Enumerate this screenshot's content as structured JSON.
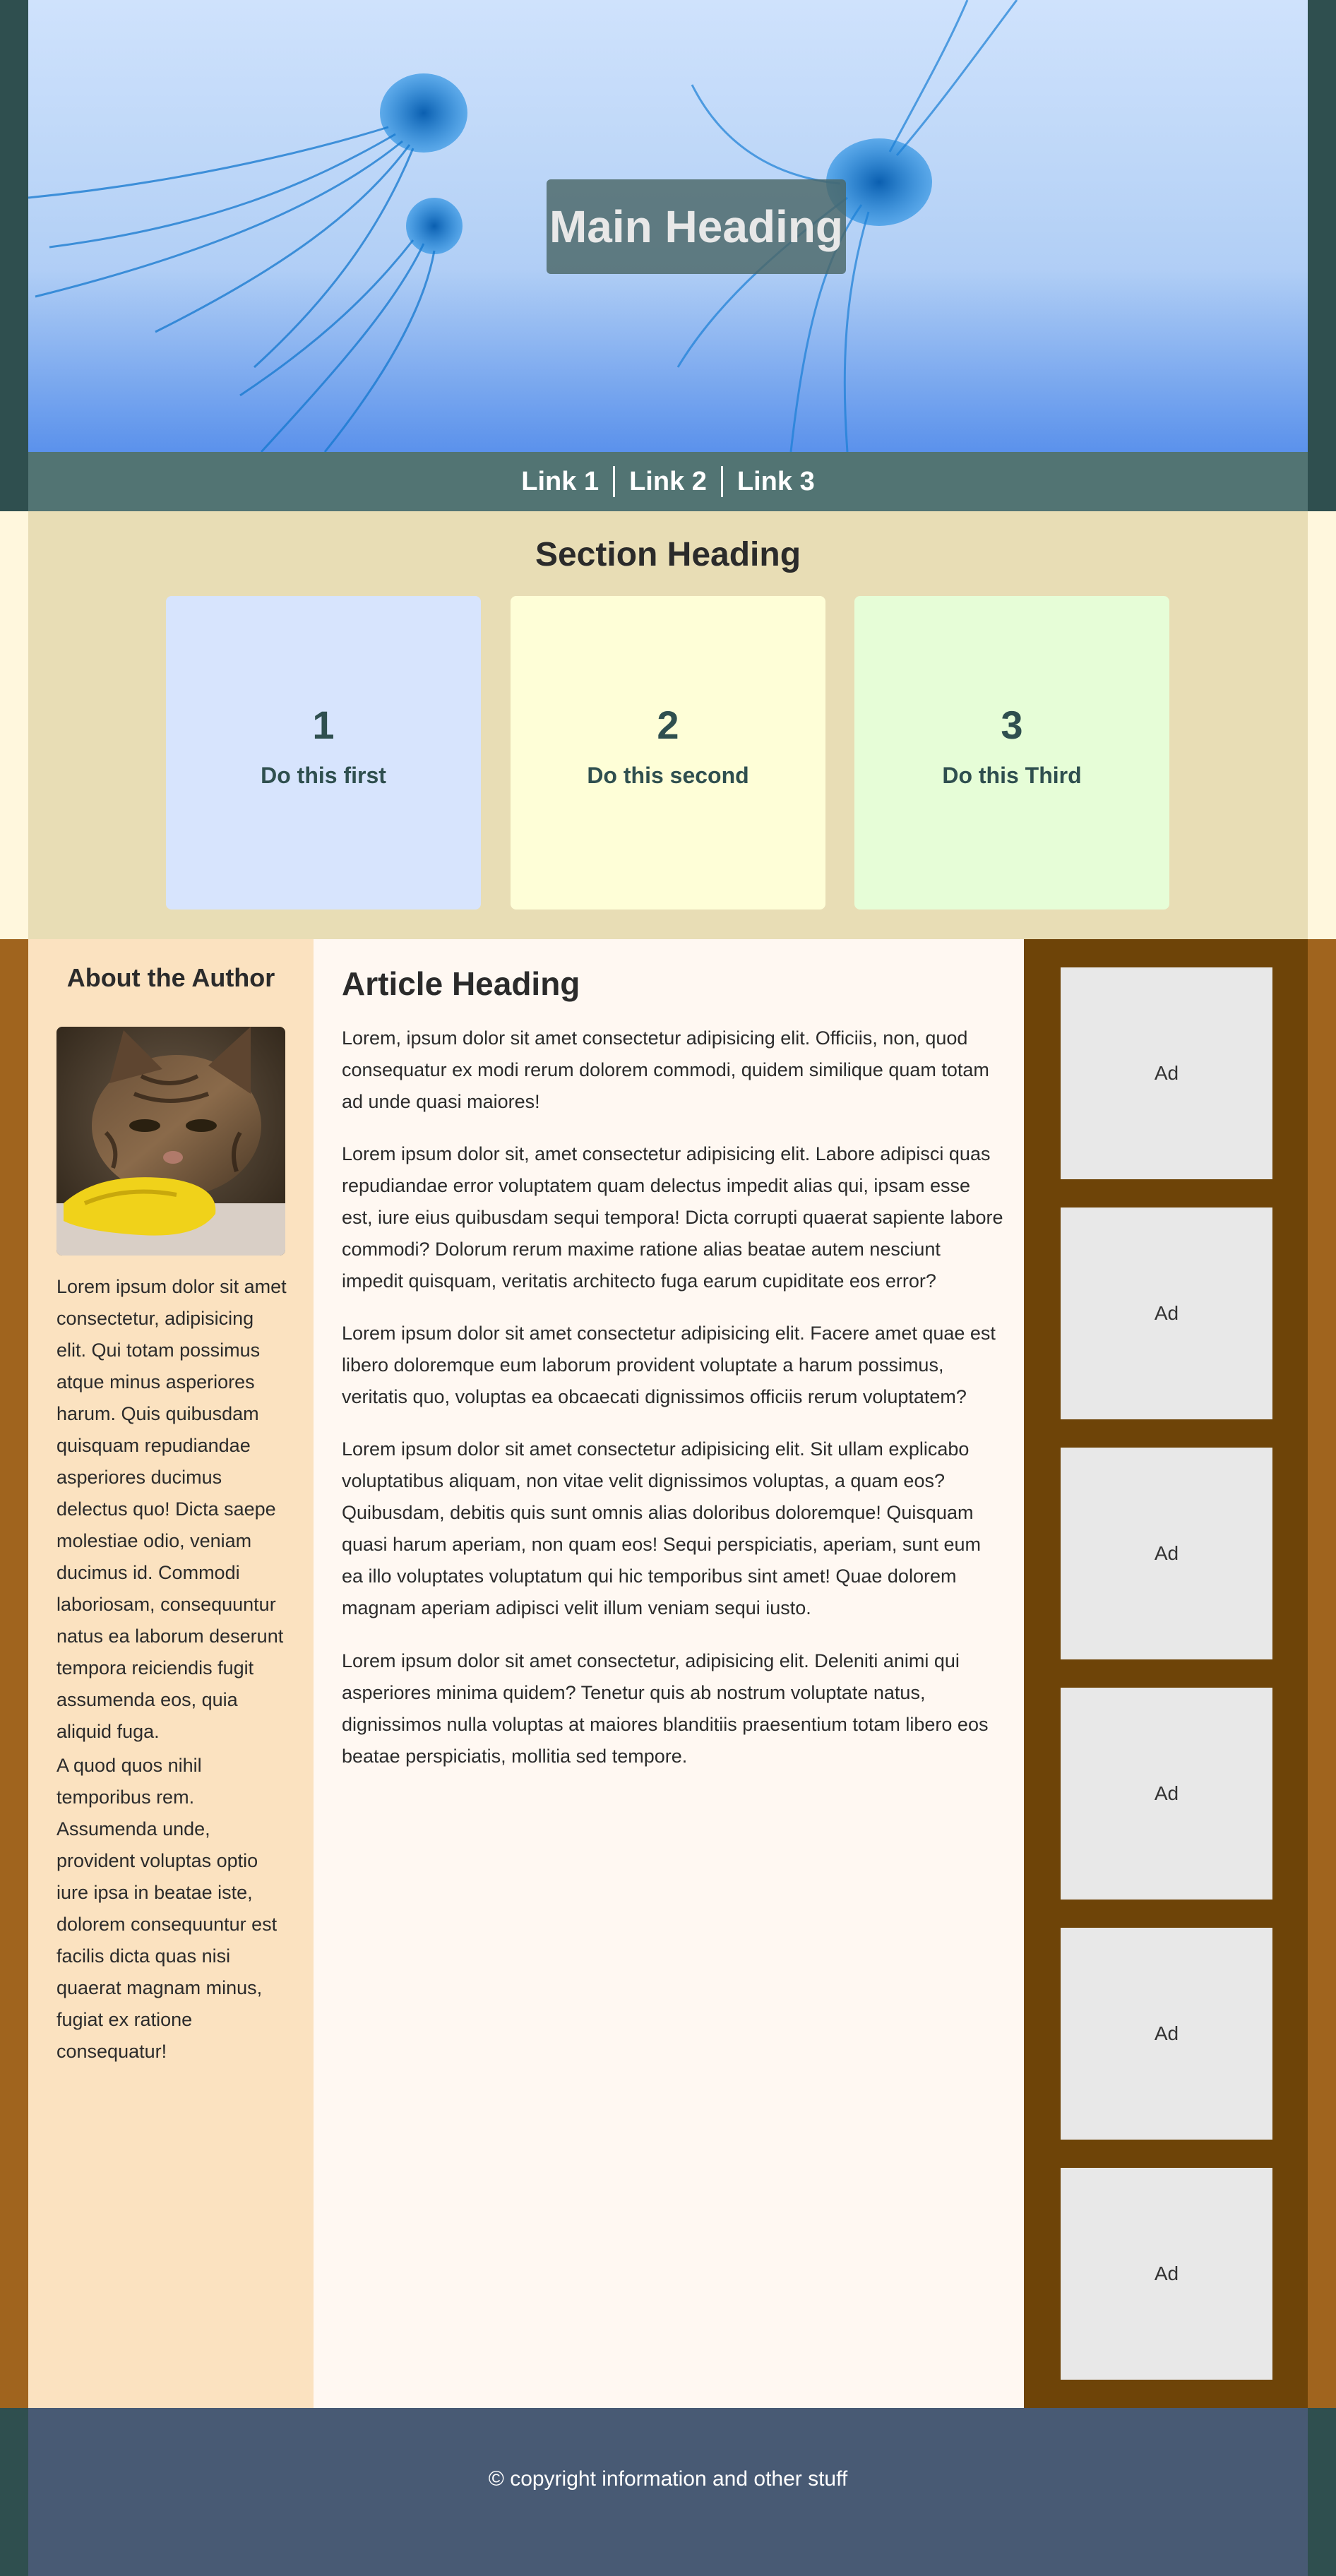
{
  "header": {
    "main_heading": "Main Heading",
    "nav": {
      "links": [
        "Link 1",
        "Link 2",
        "Link 3"
      ]
    }
  },
  "section": {
    "heading": "Section Heading",
    "steps": [
      {
        "number": "1",
        "label": "Do this first",
        "color": "#d7e4fd"
      },
      {
        "number": "2",
        "label": "Do this second",
        "color": "#fefed7"
      },
      {
        "number": "3",
        "label": "Do this Third",
        "color": "#e6fdd7"
      }
    ]
  },
  "author": {
    "heading": "About the Author",
    "image_subject": "cat-photo",
    "paragraphs": [
      "Lorem ipsum dolor sit amet consectetur, adipisicing elit. Qui totam possimus atque minus asperiores harum. Quis quibusdam quisquam repudiandae asperiores ducimus delectus quo! Dicta saepe molestiae odio, veniam ducimus id. Commodi laboriosam, consequuntur natus ea laborum deserunt tempora reiciendis fugit assumenda eos, quia aliquid fuga.",
      "A quod quos nihil temporibus rem. Assumenda unde, provident voluptas optio iure ipsa in beatae iste, dolorem consequuntur est facilis dicta quas nisi quaerat magnam minus, fugiat ex ratione consequatur!"
    ]
  },
  "article": {
    "heading": "Article Heading",
    "paragraphs": [
      "Lorem, ipsum dolor sit amet consectetur adipisicing elit. Officiis, non, quod consequatur ex modi rerum dolorem commodi, quidem similique quam totam ad unde quasi maiores!",
      "Lorem ipsum dolor sit, amet consectetur adipisicing elit. Labore adipisci quas repudiandae error voluptatem quam delectus impedit alias qui, ipsam esse est, iure eius quibusdam sequi tempora! Dicta corrupti quaerat sapiente labore commodi? Dolorum rerum maxime ratione alias beatae autem nesciunt impedit quisquam, veritatis architecto fuga earum cupiditate eos error?",
      "Lorem ipsum dolor sit amet consectetur adipisicing elit. Facere amet quae est libero doloremque eum laborum provident voluptate a harum possimus, veritatis quo, voluptas ea obcaecati dignissimos officiis rerum voluptatem?",
      "Lorem ipsum dolor sit amet consectetur adipisicing elit. Sit ullam explicabo voluptatibus aliquam, non vitae velit dignissimos voluptas, a quam eos? Quibusdam, debitis quis sunt omnis alias doloribus doloremque! Quisquam quasi harum aperiam, non quam eos! Sequi perspiciatis, aperiam, sunt eum ea illo voluptates voluptatum qui hic temporibus sint amet! Quae dolorem magnam aperiam adipisci velit illum veniam sequi iusto.",
      "Lorem ipsum dolor sit amet consectetur, adipisicing elit. Deleniti animi qui asperiores minima quidem? Tenetur quis ab nostrum voluptate natus, dignissimos nulla voluptas at maiores blanditiis praesentium totam libero eos beatae perspiciatis, mollitia sed tempore."
    ]
  },
  "ads": [
    "Ad",
    "Ad",
    "Ad",
    "Ad",
    "Ad",
    "Ad"
  ],
  "footer": {
    "text": "© copyright information and other stuff"
  },
  "colors": {
    "outer_dark": "#2f4f4f",
    "nav_bg": "#527473",
    "section_bg": "#e8ddb5",
    "main_outer": "#a0641e",
    "ads_bg": "#6e4408",
    "footer_bg": "#485a74"
  }
}
